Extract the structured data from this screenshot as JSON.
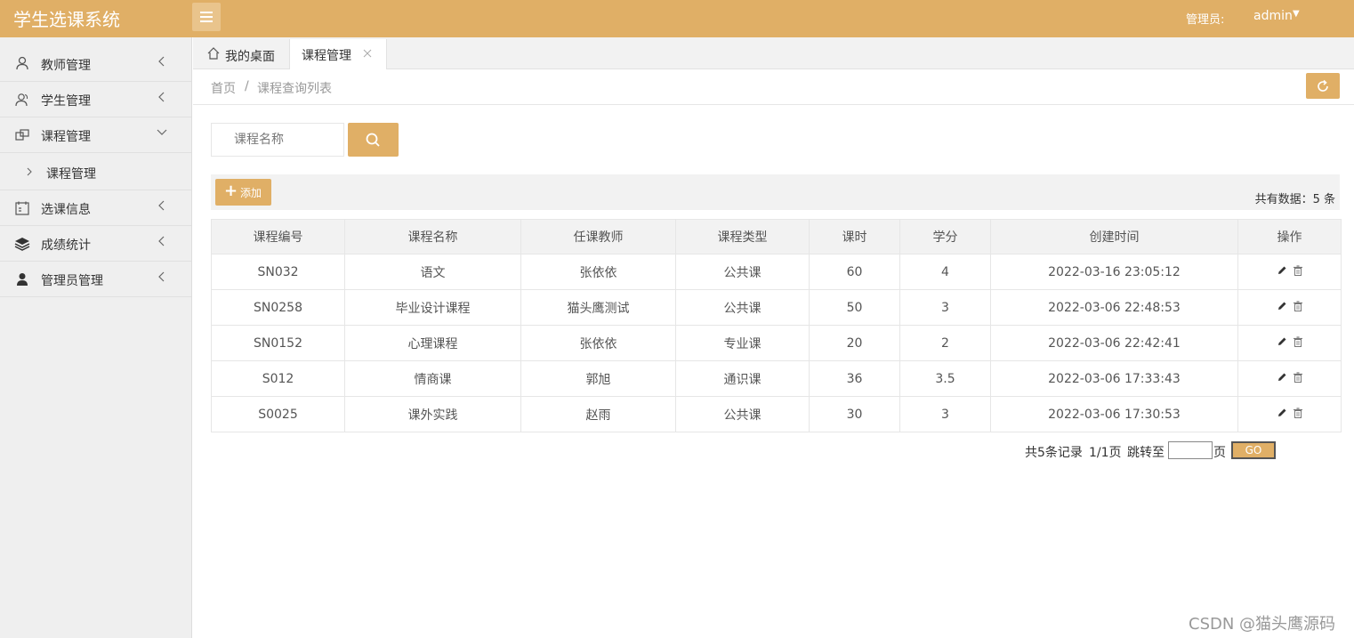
{
  "header": {
    "title": "学生选课系统",
    "admin_label": "管理员:",
    "admin_name": "admin"
  },
  "sidebar": {
    "items": [
      {
        "label": "教师管理",
        "icon": "user-icon"
      },
      {
        "label": "学生管理",
        "icon": "users-icon"
      },
      {
        "label": "课程管理",
        "icon": "course-icon",
        "expanded": true
      },
      {
        "label": "课程管理",
        "icon": "chevron-right-icon",
        "sub": true
      },
      {
        "label": "选课信息",
        "icon": "calendar-icon"
      },
      {
        "label": "成绩统计",
        "icon": "stack-icon"
      },
      {
        "label": "管理员管理",
        "icon": "person-icon"
      }
    ]
  },
  "tabs": [
    {
      "label": "我的桌面",
      "icon": "home-icon"
    },
    {
      "label": "课程管理",
      "active": true
    }
  ],
  "breadcrumb": {
    "home": "首页",
    "separator": "/",
    "current": "课程查询列表"
  },
  "search": {
    "placeholder": "课程名称"
  },
  "toolbar": {
    "add_label": "添加",
    "total": "共有数据：5 条"
  },
  "table": {
    "headers": [
      "课程编号",
      "课程名称",
      "任课教师",
      "课程类型",
      "课时",
      "学分",
      "创建时间",
      "操作"
    ],
    "rows": [
      [
        "SN032",
        "语文",
        "张依依",
        "公共课",
        "60",
        "4",
        "2022-03-16 23:05:12"
      ],
      [
        "SN0258",
        "毕业设计课程",
        "猫头鹰测试",
        "公共课",
        "50",
        "3",
        "2022-03-06 22:48:53"
      ],
      [
        "SN0152",
        "心理课程",
        "张依依",
        "专业课",
        "20",
        "2",
        "2022-03-06 22:42:41"
      ],
      [
        "S012",
        "情商课",
        "郭旭",
        "通识课",
        "36",
        "3.5",
        "2022-03-06 17:33:43"
      ],
      [
        "S0025",
        "课外实践",
        "赵雨",
        "公共课",
        "30",
        "3",
        "2022-03-06 17:30:53"
      ]
    ]
  },
  "pager": {
    "records": "共5条记录",
    "pages": "1/1页",
    "jump": "跳转至",
    "page_unit": "页",
    "go": "GO"
  },
  "watermark": "CSDN @猫头鹰源码",
  "colors": {
    "accent": "#e0af66",
    "sidebar_bg": "#efefef"
  }
}
